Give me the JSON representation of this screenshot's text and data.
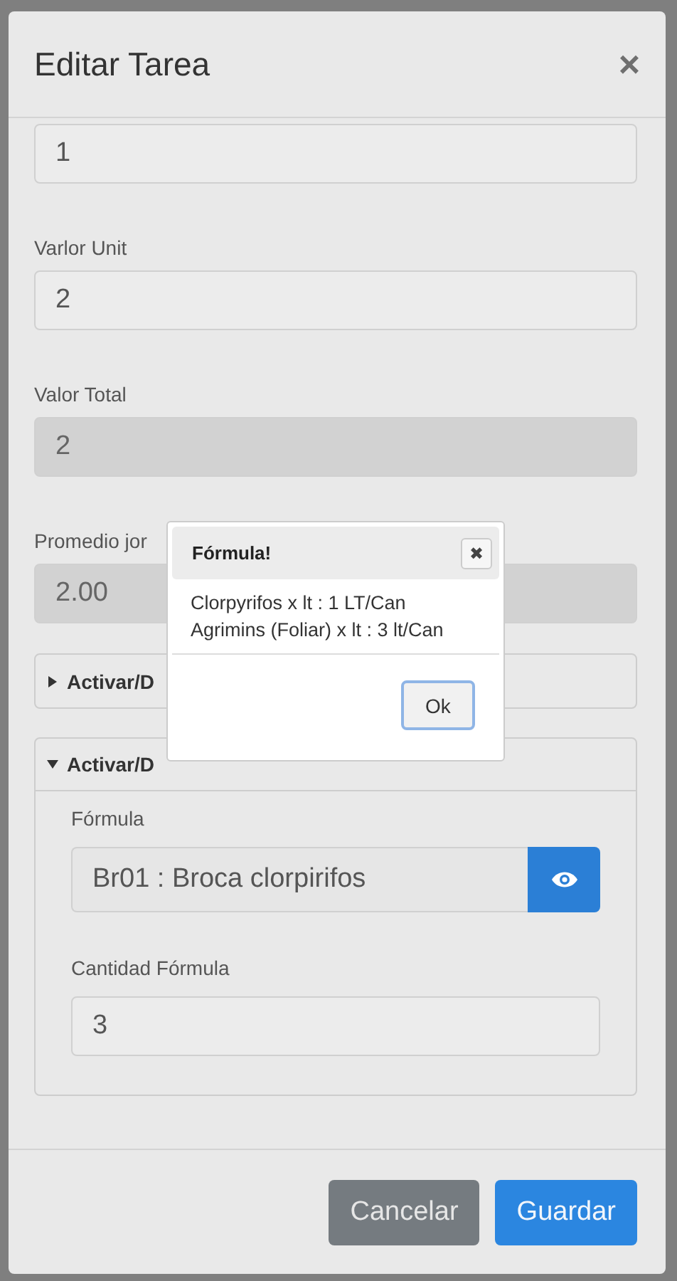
{
  "modal": {
    "title": "Editar Tarea",
    "close": "×"
  },
  "fields": [
    {
      "value": "1",
      "disabled": false
    },
    {
      "label": "Varlor Unit",
      "value": "2",
      "disabled": false
    },
    {
      "label": "Valor Total",
      "value": "2",
      "disabled": true
    },
    {
      "label": "Promedio jor",
      "value": "2.00",
      "disabled": true
    }
  ],
  "sections": [
    {
      "title": "Activar/D",
      "expanded": false
    },
    {
      "title": "Activar/D",
      "expanded": true,
      "formula_label": "Fórmula",
      "formula_value": "Br01 : Broca clorpirifos",
      "quantity_label": "Cantidad Fórmula",
      "quantity_value": "3"
    }
  ],
  "buttons": [
    {
      "label": "Cancelar",
      "kind": "secondary"
    },
    {
      "label": "Guardar",
      "kind": "primary"
    }
  ],
  "dialog": {
    "title": "Fórmula!",
    "close": "✖",
    "lines": [
      "Clorpyrifos x lt : 1 LT/Can",
      "Agrimins (Foliar) x lt : 3 lt/Can"
    ],
    "button": "Ok"
  }
}
